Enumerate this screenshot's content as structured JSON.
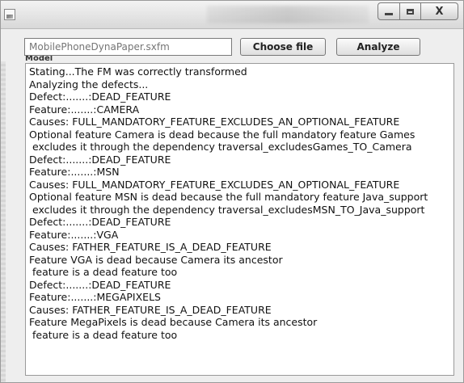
{
  "window": {
    "caption_buttons": {
      "minimize_icon": "minimize-icon",
      "maximize_icon": "maximize-icon",
      "close_symbol": "X"
    }
  },
  "toolbar": {
    "file_placeholder": "MobilePhoneDynaPaper.sxfm",
    "choose_label": "Choose file",
    "analyze_label": "Analyze",
    "model_label": "Model"
  },
  "output": {
    "lines": [
      "Stating...The FM was correctly transformed",
      "Analyzing the defects...",
      "Defect:.......:DEAD_FEATURE",
      "Feature:.......:CAMERA",
      "Causes: FULL_MANDATORY_FEATURE_EXCLUDES_AN_OPTIONAL_FEATURE",
      "Optional feature Camera is dead because the full mandatory feature Games",
      " excludes it through the dependency traversal_excludesGames_TO_Camera",
      "Defect:.......:DEAD_FEATURE",
      "Feature:.......:MSN",
      "Causes: FULL_MANDATORY_FEATURE_EXCLUDES_AN_OPTIONAL_FEATURE",
      "Optional feature MSN is dead because the full mandatory feature Java_support",
      " excludes it through the dependency traversal_excludesMSN_TO_Java_support",
      "Defect:.......:DEAD_FEATURE",
      "Feature:.......:VGA",
      "Causes: FATHER_FEATURE_IS_A_DEAD_FEATURE",
      "Feature VGA is dead because Camera its ancestor",
      " feature is a dead feature too",
      "Defect:.......:DEAD_FEATURE",
      "Feature:.......:MEGAPIXELS",
      "Causes: FATHER_FEATURE_IS_A_DEAD_FEATURE",
      "Feature MegaPixels is dead because Camera its ancestor",
      " feature is a dead feature too"
    ]
  }
}
